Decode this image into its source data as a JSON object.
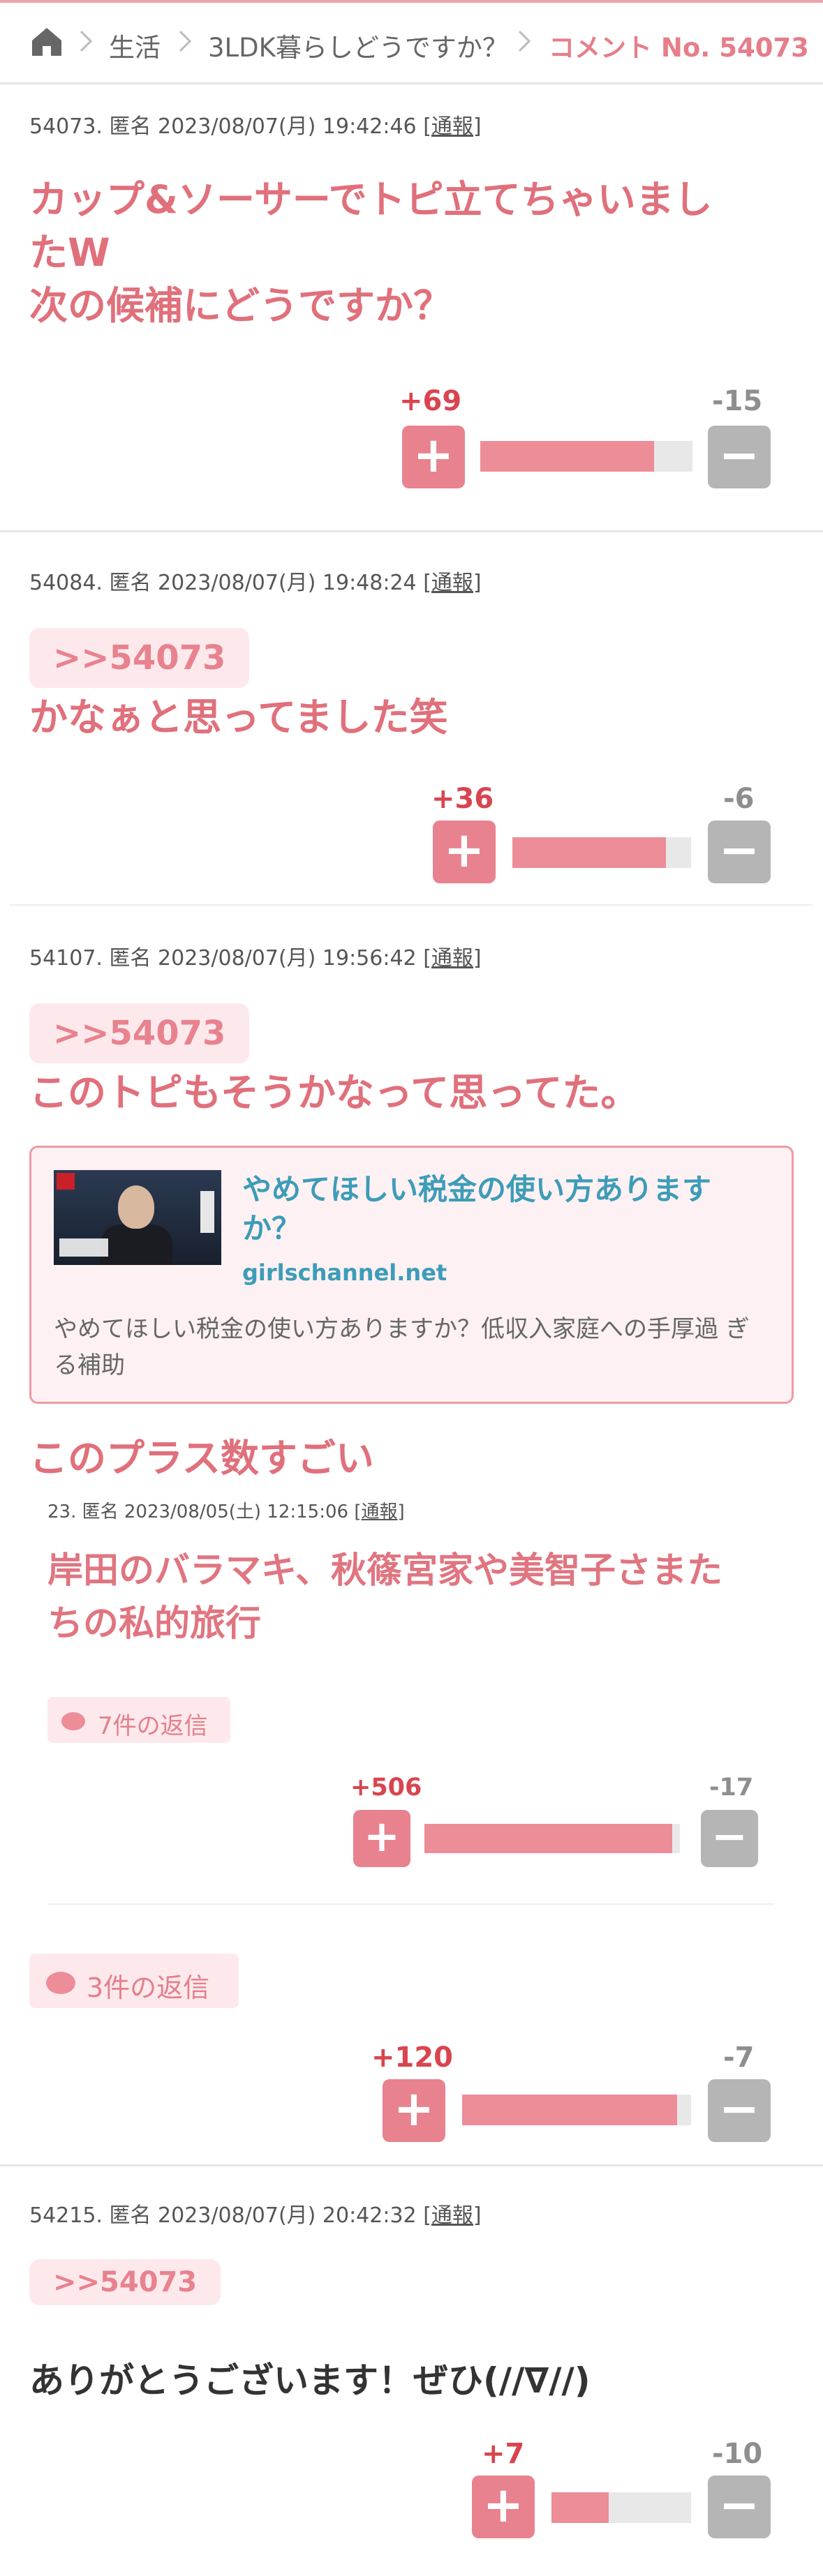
{
  "breadcrumb": {
    "home_icon": "home-icon",
    "items": [
      "生活",
      "3LDK暮らしどうですか？"
    ],
    "current": "コメント No. 54073"
  },
  "comments": [
    {
      "meta": "54073. 匿名 2023/08/07(月) 19:42:46",
      "report": "[通報]",
      "body": [
        "カップ&ソーサーでトピ立てちゃいまし",
        "たW",
        "次の候補にどうですか？"
      ],
      "plus": "+69",
      "minus": "-15",
      "ratio": 0.82
    },
    {
      "meta": "54084. 匿名 2023/08/07(月) 19:48:24",
      "report": "[通報]",
      "anchor": ">>54073",
      "body": [
        "かなぁと思ってました笑"
      ],
      "plus": "+36",
      "minus": "-6",
      "ratio": 0.86
    },
    {
      "meta": "54107. 匿名 2023/08/07(月) 19:56:42",
      "report": "[通報]",
      "anchor": ">>54073",
      "body": [
        "このトピもそうかなって思ってた。"
      ],
      "link_card": {
        "title": "やめてほしい税金の使い方あります か？",
        "domain": "girlschannel.net",
        "description": "やめてほしい税金の使い方ありますか？低収入家庭への手厚過 ぎる補助"
      },
      "quote_heading": "このプラス数すごい",
      "quoted": {
        "meta": "23. 匿名 2023/08/05(土) 12:15:06",
        "report": "[通報]",
        "body": [
          "岸田のバラマキ、秋篠宮家や美智子さまた",
          "ちの私的旅行"
        ],
        "replies": "7件の返信",
        "plus": "+506",
        "minus": "-17",
        "ratio": 0.97
      },
      "replies": "3件の返信",
      "plus": "+120",
      "minus": "-7",
      "ratio": 0.94
    },
    {
      "meta": "54215. 匿名 2023/08/07(月) 20:42:32",
      "report": "[通報]",
      "anchor": ">>54073",
      "body": [
        "ありがとうございます！ぜひ(//∇//)"
      ],
      "plus": "+7",
      "minus": "-10",
      "ratio": 0.41
    }
  ],
  "colors": {
    "accent": "#e0707b",
    "plus": "#e8828f",
    "minus": "#b5b5b5",
    "link": "#3d9cb8"
  }
}
